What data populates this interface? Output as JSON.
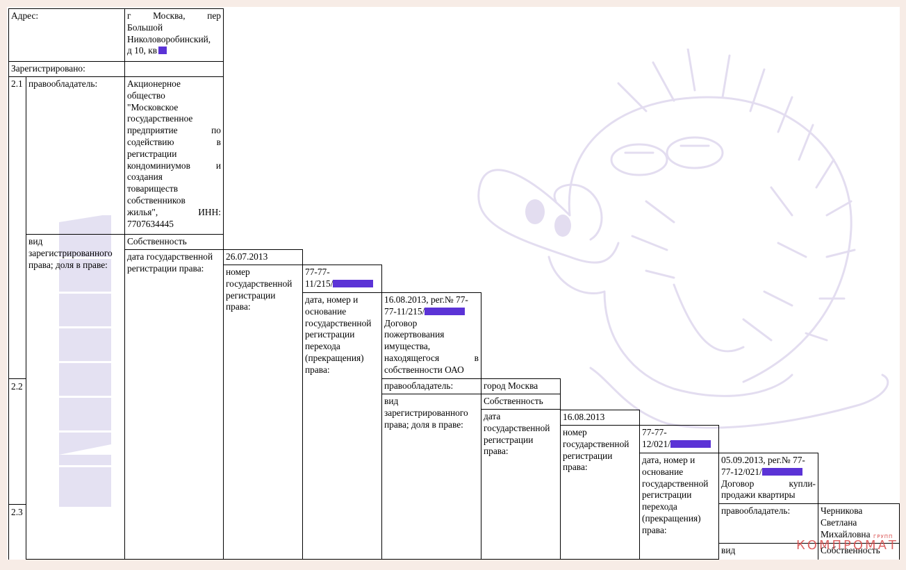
{
  "address": {
    "label": "Адрес:",
    "line1": "г Москва, пер",
    "line2": "Большой",
    "line3": "Николоворобинский,",
    "line4": "д 10, кв"
  },
  "registered_label": "Зарегистрировано:",
  "entry_2_1": {
    "num": "2.1",
    "holder_label": "правообладатель:",
    "holder_lines": [
      "Акционерное",
      "общество",
      "\"Московское",
      "государственное",
      "предприятие по",
      "содействию в",
      "регистрации",
      "кондоминиумов и",
      "создания",
      "товариществ",
      "собственников",
      "жилья\", ИНН:",
      "7707634445"
    ],
    "right_type_label": "вид зарегистрированного права; доля в праве:",
    "right_type_value": "Собственность",
    "reg_date_label": "дата государственной регистрации права:",
    "reg_date_value": "26.07.2013",
    "reg_num_label": "номер государственной регистрации права:",
    "reg_num_value_line1": "77-77-",
    "reg_num_value_line2": "11/215/",
    "transfer_label": "дата, номер и основание государственной регистрации перехода (прекращения) права:",
    "transfer_line1": "16.08.2013, рег.№ 77-",
    "transfer_line2": "77-11/215/",
    "transfer_line3": "Договор",
    "transfer_line4": "пожертвования",
    "transfer_line5": "имущества,",
    "transfer_line6": "находящегося в",
    "transfer_line7": "собственности ОАО"
  },
  "entry_2_2": {
    "num": "2.2",
    "holder_label": "правообладатель:",
    "holder_value": "город Москва",
    "right_type_label": "вид зарегистрированного права; доля в праве:",
    "right_type_value": "Собственность",
    "reg_date_label": "дата государственной регистрации права:",
    "reg_date_value": "16.08.2013",
    "reg_num_label": "номер государственной регистрации права:",
    "reg_num_value_line1": "77-77-",
    "reg_num_value_line2": "12/021/",
    "transfer_label": "дата, номер и основание государственной регистрации перехода (прекращения) права:",
    "transfer_line1": "05.09.2013, рег.№ 77-",
    "transfer_line2": "77-12/021/",
    "transfer_line3": "Договор купли-",
    "transfer_line4": "продажи квартиры"
  },
  "entry_2_3": {
    "num": "2.3",
    "holder_label": "правообладатель:",
    "holder_line1": "Черникова",
    "holder_line2": "Светлана",
    "holder_line3": "Михайловна",
    "right_type_label_partial": "вид",
    "right_type_value": "Собственность"
  },
  "watermarks": {
    "brand": "КОМПРОМАТ",
    "brand_sub": "ГРУПП",
    "colors": {
      "redaction": "#5b33d6",
      "hedgehog": "#e3ddf0",
      "baza": "#e4e1f2",
      "brand": "#d94a4a"
    }
  }
}
